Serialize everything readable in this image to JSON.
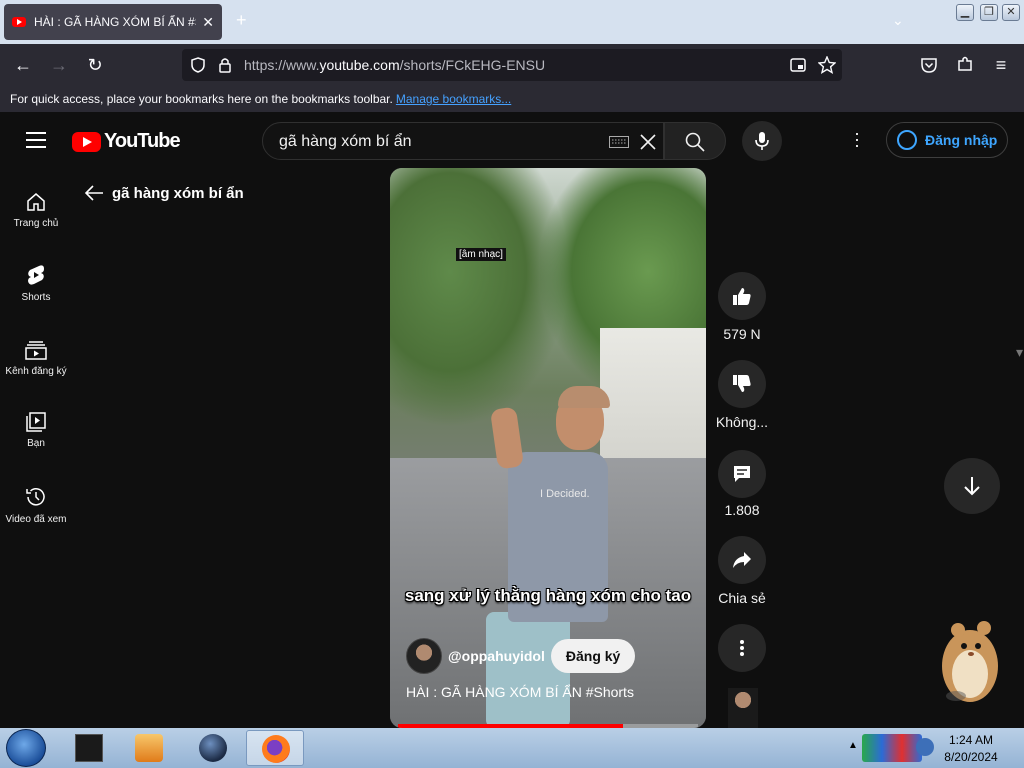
{
  "browser": {
    "tab_title": "HÀI : GÃ HÀNG XÓM BÍ ẨN #Sh",
    "url_prefix": "https://www.",
    "url_domain": "youtube.com",
    "url_path": "/shorts/FCkEHG-ENSU",
    "bookmarks_message": "For quick access, place your bookmarks here on the bookmarks toolbar.",
    "manage_bookmarks": "Manage bookmarks..."
  },
  "youtube": {
    "logo_text": "YouTube",
    "search_value": "gã hàng xóm bí ẩn",
    "signin_label": "Đăng nhập",
    "sidebar": [
      {
        "label": "Trang chủ",
        "icon": "home-icon"
      },
      {
        "label": "Shorts",
        "icon": "shorts-icon"
      },
      {
        "label": "Kênh đăng ký",
        "icon": "subscriptions-icon"
      },
      {
        "label": "Bạn",
        "icon": "you-icon"
      },
      {
        "label": "Video đã xem",
        "icon": "history-icon"
      }
    ],
    "back_query": "gã hàng xóm bí ẩn",
    "video": {
      "music_tag": "[âm nhạc]",
      "shirt_text": "I Decided.",
      "caption": "sang xử lý thằng hàng xóm cho tao",
      "channel": "@oppahuyidol",
      "subscribe_label": "Đăng ký",
      "title": "HÀI : GÃ HÀNG XÓM BÍ ẨN #Shorts",
      "progress_fraction": 0.75
    },
    "actions": {
      "likes": "579 N",
      "dislike": "Không...",
      "comments": "1.808",
      "share": "Chia sẻ"
    }
  },
  "taskbar": {
    "time": "1:24 AM",
    "date": "8/20/2024"
  },
  "colors": {
    "yt_red": "#ff0000",
    "link_blue": "#3ea6ff",
    "bg": "#0f0f0f"
  }
}
